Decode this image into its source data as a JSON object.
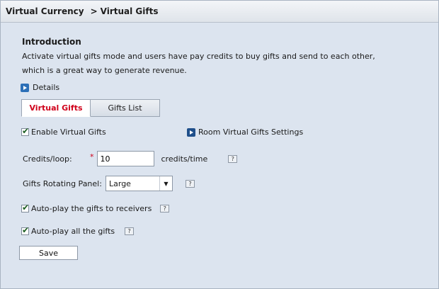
{
  "breadcrumb": {
    "parent": "Virtual Currency",
    "separator": ">",
    "current": "Virtual Gifts"
  },
  "intro": {
    "title": "Introduction",
    "text": "Activate virtual gifts mode and users have pay credits to buy gifts and send to each other, which is a great way to generate revenue."
  },
  "details_link": "Details",
  "tabs": [
    {
      "label": "Virtual Gifts",
      "active": true
    },
    {
      "label": "Gifts List",
      "active": false
    }
  ],
  "enable_virtual_gifts": {
    "label": "Enable Virtual Gifts",
    "checked": true
  },
  "room_settings_link": "Room Virtual Gifts Settings",
  "credits": {
    "label": "Credits/loop:",
    "required_mark": "*",
    "value": "10",
    "unit": "credits/time"
  },
  "rotating_panel": {
    "label": "Gifts Rotating Panel:",
    "selected": "Large"
  },
  "autoplay_receivers": {
    "label": "Auto-play the gifts to receivers",
    "checked": true
  },
  "autoplay_all": {
    "label": "Auto-play all the gifts",
    "checked": true
  },
  "help_glyph": "?",
  "save_label": "Save",
  "colors": {
    "active_tab_text": "#d0021b",
    "icon_blue": "#1f4f8b",
    "panel_bg": "#dce4ef"
  }
}
